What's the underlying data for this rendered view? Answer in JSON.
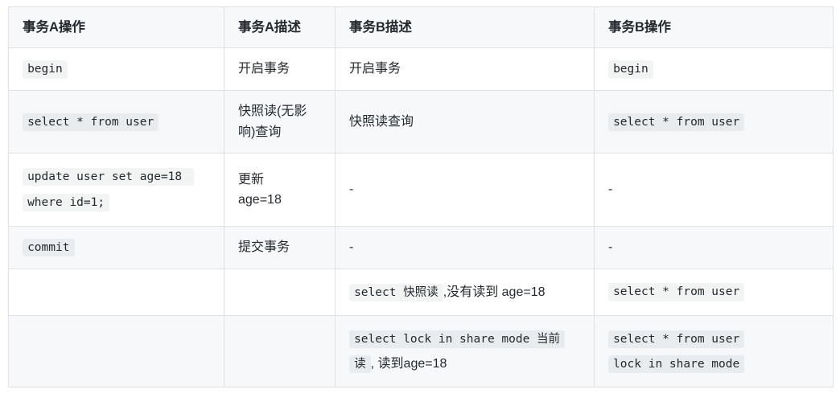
{
  "table": {
    "columns": [
      {
        "id": "a_op",
        "label": "事务A操作"
      },
      {
        "id": "a_desc",
        "label": "事务A描述"
      },
      {
        "id": "b_desc",
        "label": "事务B描述"
      },
      {
        "id": "b_op",
        "label": "事务B操作"
      }
    ],
    "rows": [
      {
        "a_op_code": "begin",
        "a_desc": "开启事务",
        "b_desc": "开启事务",
        "b_op_code": "begin"
      },
      {
        "a_op_code": "select * from user",
        "a_desc": "快照读(无影响)查询",
        "b_desc": "快照读查询",
        "b_op_code": "select * from user"
      },
      {
        "a_op_code": "update user set age=18 where id=1;",
        "a_desc_line1": "更新",
        "a_desc_line2": "age=18",
        "b_desc": "-",
        "b_op": "-"
      },
      {
        "a_op_code": "commit",
        "a_desc": "提交事务",
        "b_desc": "-",
        "b_op": "-"
      },
      {
        "a_op": "",
        "a_desc": "",
        "b_desc_code": "select 快照读",
        "b_desc_text": ",没有读到 age=18",
        "b_op_code": "select * from user"
      },
      {
        "a_op": "",
        "a_desc": "",
        "b_desc_code": "select lock in share mode 当前读",
        "b_desc_text": ", 读到age=18",
        "b_op_code1": "select * from user",
        "b_op_code2": "lock in share mode"
      }
    ]
  },
  "colors": {
    "border": "#dfe2e5",
    "header_bg": "#f6f8fa",
    "stripe_bg": "#f6f8fa",
    "row_bg": "#ffffff",
    "text": "#24292e",
    "code_bg": "rgba(27,31,35,0.055)"
  }
}
